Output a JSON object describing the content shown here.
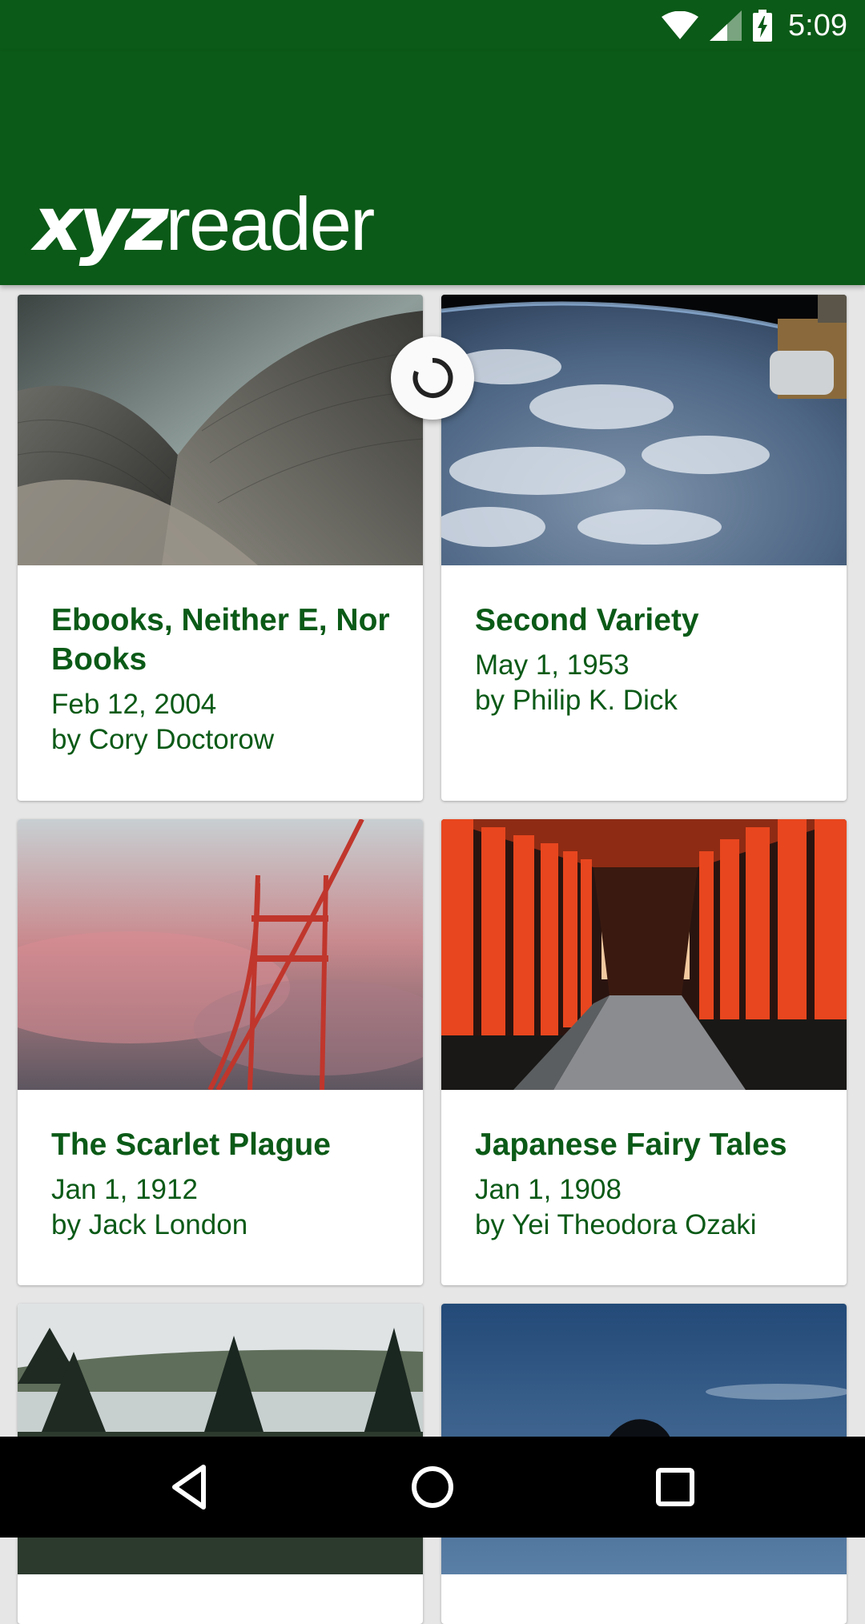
{
  "status_bar": {
    "time": "5:09",
    "icons": [
      "wifi-icon",
      "signal-icon",
      "battery-charging-icon"
    ]
  },
  "app": {
    "title_bold": "xyz",
    "title_regular": "reader",
    "brand_color": "#0b5a17"
  },
  "articles": [
    {
      "title": "Ebooks, Neither E, Nor Books",
      "date": "Feb 12, 2004",
      "author": "by Cory Doctorow"
    },
    {
      "title": "Second Variety",
      "date": "May 1, 1953",
      "author": "by Philip K. Dick"
    },
    {
      "title": "The Scarlet Plague",
      "date": "Jan 1, 1912",
      "author": "by Jack London"
    },
    {
      "title": "Japanese Fairy Tales",
      "date": "Jan 1, 1908",
      "author": "by Yei Theodora Ozaki"
    }
  ],
  "nav_bar": {
    "buttons": [
      "back-icon",
      "home-icon",
      "recents-icon"
    ]
  }
}
